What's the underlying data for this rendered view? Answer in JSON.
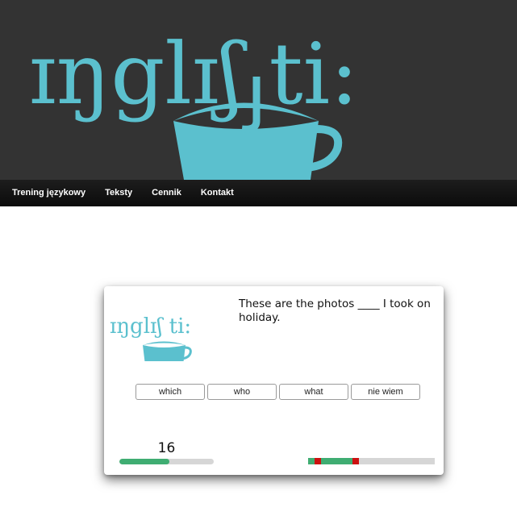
{
  "header": {
    "logo_text": "ɪŋglɪʃ ti:",
    "logo_color": "#5bc0ce",
    "background": "#333333"
  },
  "nav": {
    "items": [
      "Trening językowy",
      "Teksty",
      "Cennik",
      "Kontakt"
    ]
  },
  "quiz": {
    "logo_text": "ɪŋglɪʃ ti:",
    "question": "These are the photos ____ I took on holiday.",
    "answers": [
      "which",
      "who",
      "what",
      "nie wiem"
    ],
    "counter": "16",
    "timer_fraction": 0.53,
    "progress": [
      "correct",
      "wrong",
      "correct",
      "correct",
      "correct",
      "correct",
      "correct",
      "wrong",
      "empty",
      "empty",
      "empty",
      "empty",
      "empty",
      "empty",
      "empty",
      "empty",
      "empty",
      "empty",
      "empty",
      "empty"
    ],
    "colors": {
      "correct": "#3fad72",
      "wrong": "#cc1111",
      "empty": "#d6d6d6",
      "accent": "#5bc0ce"
    }
  }
}
